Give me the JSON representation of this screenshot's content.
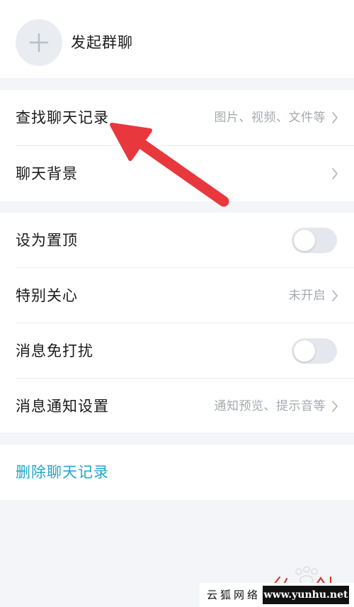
{
  "header": {
    "start_group_chat": "发起群聊",
    "plus_icon": "plus-icon"
  },
  "chat_tools": {
    "find_history": {
      "label": "查找聊天记录",
      "subtitle": "图片、视频、文件等"
    },
    "chat_background": {
      "label": "聊天背景"
    }
  },
  "settings": {
    "pin_top": {
      "label": "设为置顶",
      "enabled": false
    },
    "special_care": {
      "label": "特别关心",
      "status": "未开启"
    },
    "do_not_disturb": {
      "label": "消息免打扰",
      "enabled": false
    },
    "notification_settings": {
      "label": "消息通知设置",
      "subtitle": "通知预览、提示音等"
    }
  },
  "danger": {
    "delete_history": "删除聊天记录"
  },
  "watermark": {
    "site_name": "云狐网络",
    "site_url": "www.yunhu.net"
  },
  "colors": {
    "accent": "#23a6c8",
    "annotation_arrow": "#e8383d",
    "page_background": "#f3f5f8",
    "toggle_off": "#e4e8ee"
  }
}
